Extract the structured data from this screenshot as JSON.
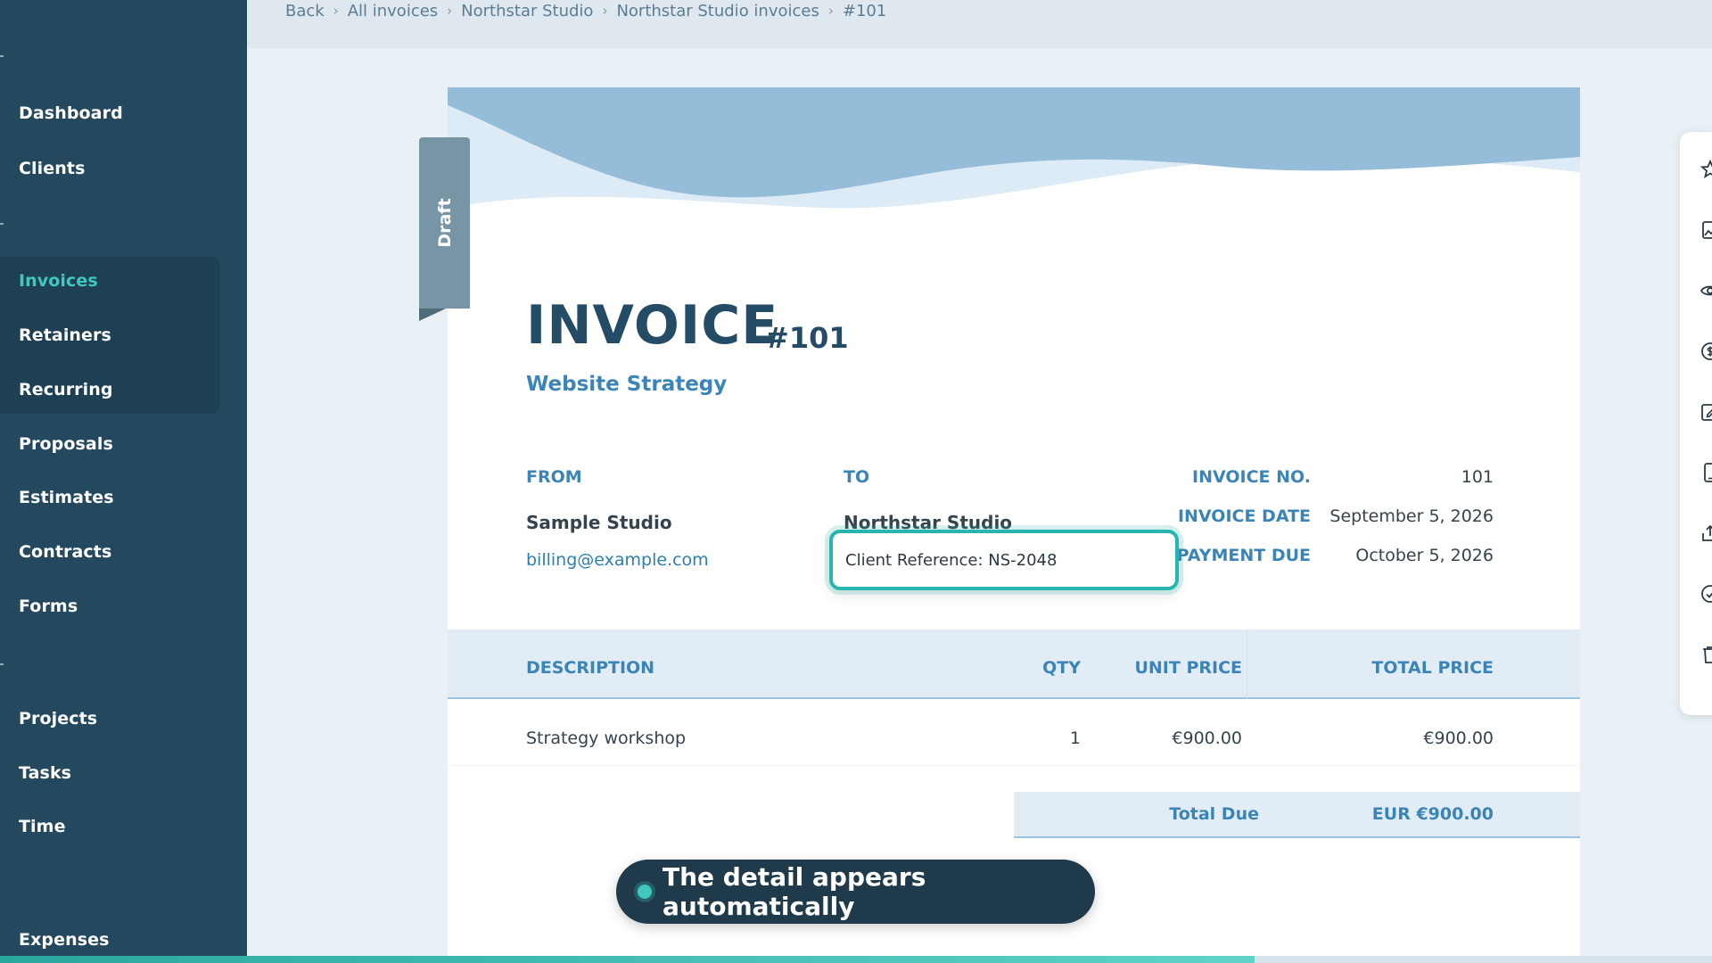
{
  "breadcrumb": [
    "Back",
    "All invoices",
    "Northstar Studio",
    "Northstar Studio invoices",
    "#101"
  ],
  "sidebar": {
    "items": [
      {
        "label": "Dashboard"
      },
      {
        "label": "Clients"
      },
      {
        "label": "Invoices",
        "active": true
      },
      {
        "label": "Retainers"
      },
      {
        "label": "Recurring"
      },
      {
        "label": "Proposals"
      },
      {
        "label": "Estimates"
      },
      {
        "label": "Contracts"
      },
      {
        "label": "Forms"
      },
      {
        "label": "Projects"
      },
      {
        "label": "Tasks"
      },
      {
        "label": "Time"
      },
      {
        "label": "Expenses"
      }
    ]
  },
  "invoice": {
    "status": "Draft",
    "title": "INVOICE",
    "number": "#101",
    "subtitle": "Website Strategy",
    "from_label": "FROM",
    "from_name": "Sample Studio",
    "from_email": "billing@example.com",
    "to_label": "TO",
    "to_name": "Northstar Studio",
    "client_reference": "Client Reference: NS-2048",
    "invoice_no_label": "INVOICE NO.",
    "invoice_no": "101",
    "invoice_date_label": "INVOICE DATE",
    "invoice_date": "September 5, 2026",
    "payment_due_label": "PAYMENT DUE",
    "payment_due": "October 5, 2026",
    "table": {
      "headers": [
        "DESCRIPTION",
        "QTY",
        "UNIT PRICE",
        "TOTAL PRICE"
      ],
      "rows": [
        {
          "description": "Strategy workshop",
          "qty": "1",
          "unit_price": "€900.00",
          "total_price": "€900.00"
        }
      ]
    },
    "total_label": "Total Due",
    "total_value": "EUR €900.00"
  },
  "toolbar": {
    "icons": [
      "star-icon",
      "image-icon",
      "eye-icon",
      "dollar-icon",
      "edit-icon",
      "mobile-icon",
      "share-icon",
      "check-circle-icon",
      "trash-icon"
    ]
  },
  "toast": {
    "message": "The detail appears automatically"
  },
  "progress": {
    "fraction": 0.733
  },
  "colors": {
    "sidebar": "#24495f",
    "accent": "#3fc8bd",
    "brand_blue": "#3b84b8",
    "heading": "#244c66"
  }
}
